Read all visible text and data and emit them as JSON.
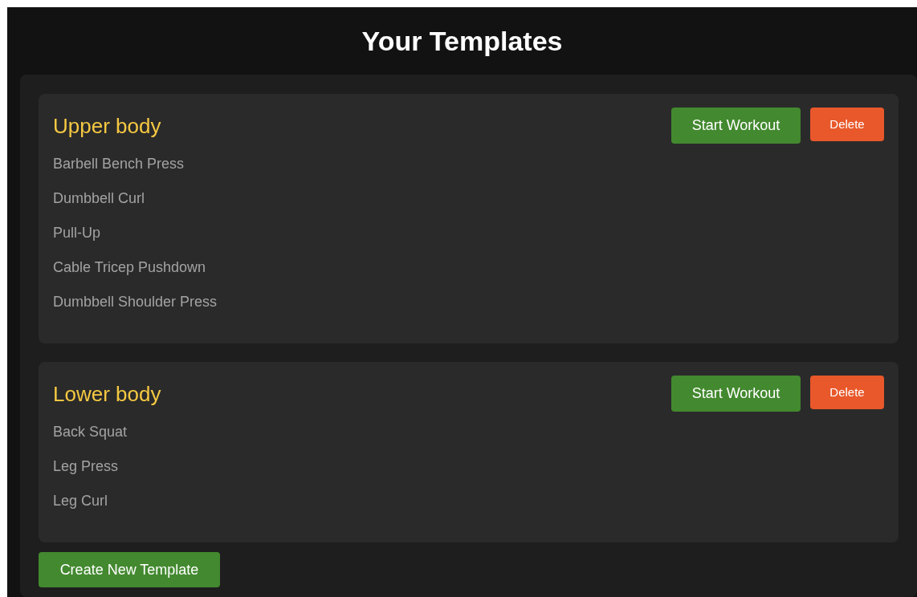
{
  "title": "Your Templates",
  "templates": [
    {
      "name": "Upper body",
      "exercises": [
        "Barbell Bench Press",
        "Dumbbell Curl",
        "Pull-Up",
        "Cable Tricep Pushdown",
        "Dumbbell Shoulder Press"
      ],
      "start_label": "Start Workout",
      "delete_label": "Delete"
    },
    {
      "name": "Lower body",
      "exercises": [
        "Back Squat",
        "Leg Press",
        "Leg Curl"
      ],
      "start_label": "Start Workout",
      "delete_label": "Delete"
    }
  ],
  "create_button": "Create New Template"
}
